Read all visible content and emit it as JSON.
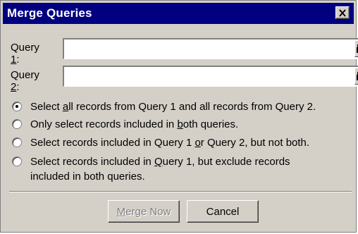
{
  "window": {
    "title": "Merge Queries",
    "close_glyph": "✕"
  },
  "fields": [
    {
      "label_underlined": "Query ",
      "label_key": "1",
      "label_suffix": ":",
      "value": "",
      "lookup_icon": "binoculars-icon"
    },
    {
      "label_underlined": "Query ",
      "label_key": "2",
      "label_suffix": ":",
      "value": "",
      "lookup_icon": "binoculars-icon"
    }
  ],
  "options": {
    "selected_index": 0,
    "items": [
      {
        "pre": "Select ",
        "key": "a",
        "post": "ll records from Query 1 and all records from Query 2."
      },
      {
        "pre": "Only select records included in ",
        "key": "b",
        "post": "oth queries."
      },
      {
        "pre": "Select records included in Query 1 ",
        "key": "o",
        "post": "r Query 2, but not both."
      },
      {
        "pre": "Select records included in ",
        "key": "Q",
        "post": "uery 1, but exclude records",
        "line2": "included in both queries."
      }
    ]
  },
  "buttons": {
    "merge_key": "M",
    "merge_rest": "erge Now",
    "merge_disabled": true,
    "cancel": "Cancel"
  },
  "colors": {
    "title_bar": "#000080",
    "dialog_bg": "#d4d0c8"
  }
}
